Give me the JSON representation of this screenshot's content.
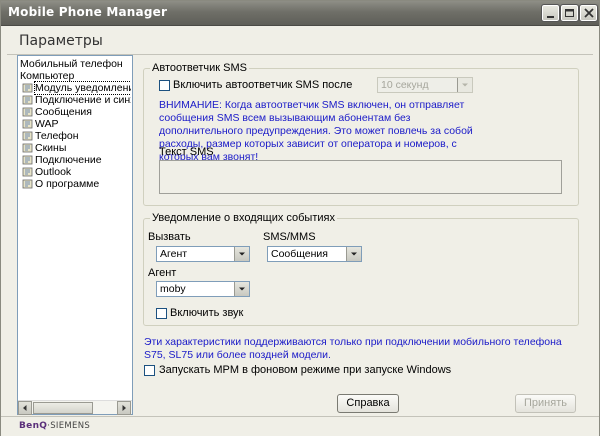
{
  "window": {
    "title": "Mobile Phone Manager"
  },
  "page": {
    "title": "Параметры"
  },
  "tree": {
    "items": [
      {
        "label": "Мобильный телефон",
        "icon": "none"
      },
      {
        "label": "Компьютер",
        "icon": "none"
      },
      {
        "label": "Модуль уведомления и",
        "icon": "settings-icon",
        "selected": true
      },
      {
        "label": "Подключение и синхро",
        "icon": "settings-icon"
      },
      {
        "label": "Сообщения",
        "icon": "settings-icon"
      },
      {
        "label": "WAP",
        "icon": "settings-icon"
      },
      {
        "label": "Телефон",
        "icon": "settings-icon"
      },
      {
        "label": "Скины",
        "icon": "settings-icon"
      },
      {
        "label": "Подключение",
        "icon": "settings-icon"
      },
      {
        "label": "Outlook",
        "icon": "settings-icon"
      },
      {
        "label": "О программе",
        "icon": "settings-icon"
      }
    ]
  },
  "sms_autoresponder": {
    "legend": "Автоответчик SMS",
    "enable_label": "Включить автоответчик SMS после",
    "enable_checked": false,
    "delay_value": "10 секунд",
    "warning": "ВНИМАНИЕ: Когда автоответчик SMS включен, он отправляет сообщения SMS всем вызывающим абонентам без дополнительного предупреждения. Это может повлечь за собой расходы, размер которых зависит от оператора и номеров, с которых вам звонят!",
    "text_label": "Текст SMS"
  },
  "notifications": {
    "legend": "Уведомление о входящих событиях",
    "call_label": "Вызвать",
    "call_value": "Агент",
    "sms_label": "SMS/MMS",
    "sms_value": "Сообщения",
    "agent_label": "Агент",
    "agent_value": "moby",
    "sound_label": "Включить звук",
    "sound_checked": false
  },
  "support_note": "Эти характеристики поддерживаются только при подключении мобильного телефона S75, SL75 или более поздней модели.",
  "startup": {
    "label": "Запускать MPM в фоновом режиме при запуске Windows",
    "checked": false
  },
  "buttons": {
    "help": "Справка",
    "apply": "Принять"
  },
  "footer": {
    "brand_b": "BenQ",
    "brand_rest": "·SIEMENS"
  },
  "colors": {
    "warning_text": "#1a1ac8",
    "titlebar": "#6f6f68"
  }
}
